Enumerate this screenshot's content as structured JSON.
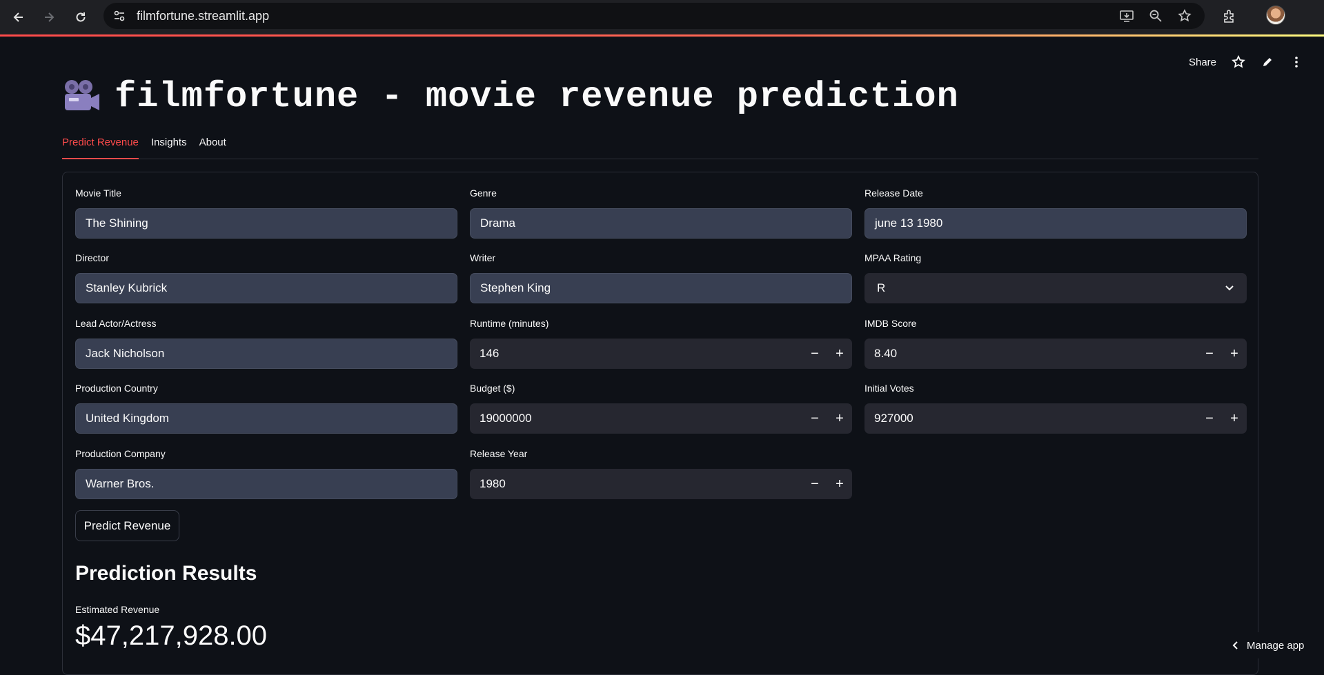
{
  "browser": {
    "url": "filmfortune.streamlit.app"
  },
  "header": {
    "share_label": "Share"
  },
  "page": {
    "title": "filmfortune - movie revenue prediction"
  },
  "tabs": [
    {
      "label": "Predict Revenue",
      "active": true
    },
    {
      "label": "Insights",
      "active": false
    },
    {
      "label": "About",
      "active": false
    }
  ],
  "form": {
    "movie_title": {
      "label": "Movie Title",
      "value": "The Shining"
    },
    "genre": {
      "label": "Genre",
      "value": "Drama"
    },
    "release_date": {
      "label": "Release Date",
      "value": "june 13 1980"
    },
    "director": {
      "label": "Director",
      "value": "Stanley Kubrick"
    },
    "writer": {
      "label": "Writer",
      "value": "Stephen King"
    },
    "mpaa_rating": {
      "label": "MPAA Rating",
      "value": "R"
    },
    "lead_actor": {
      "label": "Lead Actor/Actress",
      "value": "Jack Nicholson"
    },
    "runtime": {
      "label": "Runtime (minutes)",
      "value": "146"
    },
    "imdb_score": {
      "label": "IMDB Score",
      "value": "8.40"
    },
    "production_country": {
      "label": "Production Country",
      "value": "United Kingdom"
    },
    "budget": {
      "label": "Budget ($)",
      "value": "19000000"
    },
    "initial_votes": {
      "label": "Initial Votes",
      "value": "927000"
    },
    "production_company": {
      "label": "Production Company",
      "value": "Warner Bros."
    },
    "release_year": {
      "label": "Release Year",
      "value": "1980"
    },
    "stepper_minus": "−",
    "stepper_plus": "+",
    "predict_button": "Predict Revenue"
  },
  "results": {
    "heading": "Prediction Results",
    "metric_label": "Estimated Revenue",
    "metric_value": "$47,217,928.00"
  },
  "footer": {
    "manage_app": "Manage app"
  }
}
